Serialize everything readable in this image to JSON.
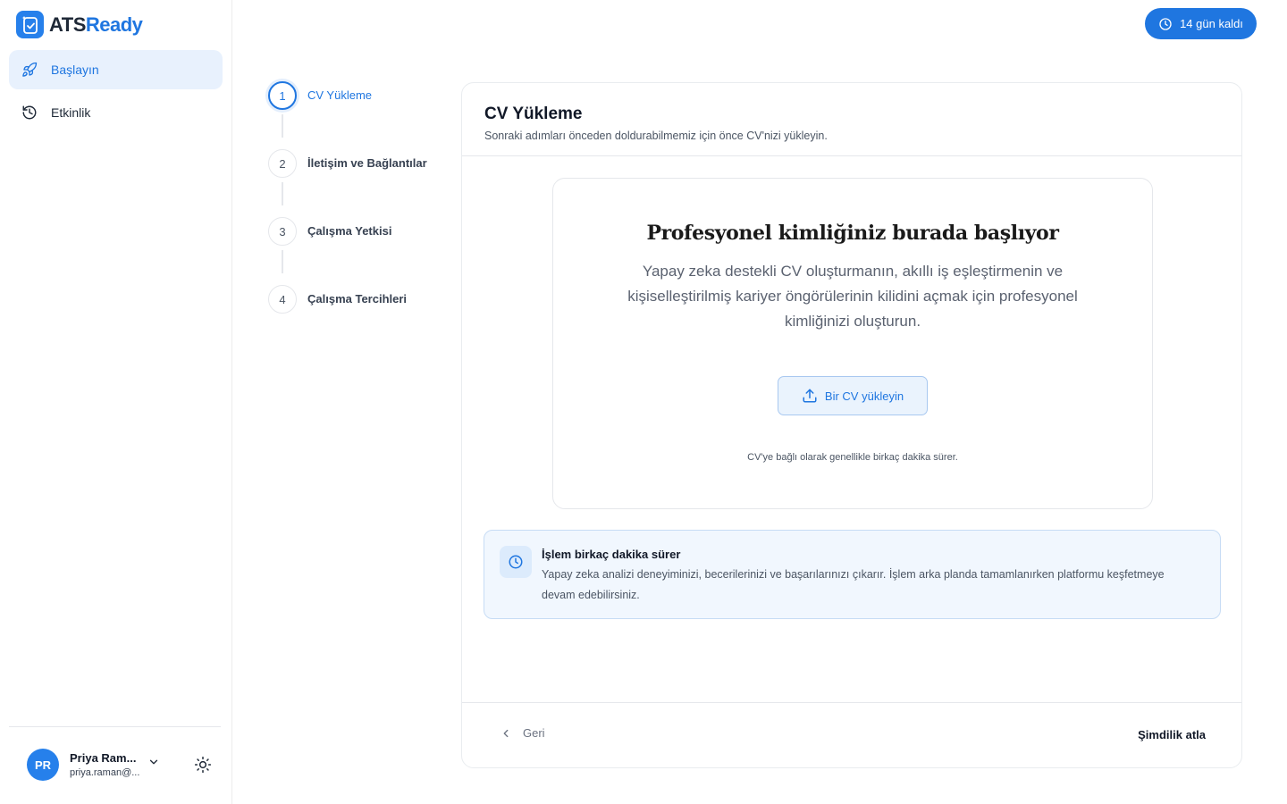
{
  "app": {
    "logo_prefix": "ATS",
    "logo_accent": "Ready",
    "brand_color": "#1f76e0"
  },
  "sidebar": {
    "items": [
      {
        "label": "Başlayın",
        "icon": "rocket-icon",
        "active": true
      },
      {
        "label": "Etkinlik",
        "icon": "history-icon",
        "active": false
      }
    ]
  },
  "user": {
    "initials": "PR",
    "name": "Priya Ram...",
    "email": "priya.raman@..."
  },
  "trial": {
    "label": "14 gün kaldı",
    "icon": "clock-icon"
  },
  "steps": [
    {
      "number": "1",
      "label": "CV Yükleme",
      "active": true
    },
    {
      "number": "2",
      "label": "İletişim ve Bağlantılar",
      "active": false
    },
    {
      "number": "3",
      "label": "Çalışma Yetkisi",
      "active": false
    },
    {
      "number": "4",
      "label": "Çalışma Tercihleri",
      "active": false
    }
  ],
  "card": {
    "title": "CV Yükleme",
    "subtitle": "Sonraki adımları önceden doldurabilmemiz için önce CV'nizi yükleyin.",
    "hero_title": "Profesyonel kimliğiniz burada başlıyor",
    "hero_desc": "Yapay zeka destekli CV oluşturmanın, akıllı iş eşleştirmenin ve kişiselleştirilmiş kariyer öngörülerinin kilidini açmak için profesyonel kimliğinizi oluşturun.",
    "upload_label": "Bir CV yükleyin",
    "upload_note": "CV'ye bağlı olarak genellikle birkaç dakika sürer.",
    "info_title": "İşlem birkaç dakika sürer",
    "info_text": "Yapay zeka analizi deneyiminizi, becerilerinizi ve başarılarınızı çıkarır. İşlem arka planda tamamlanırken platformu keşfetmeye devam edebilirsiniz.",
    "back_label": "Geri",
    "skip_label": "Şimdilik atla"
  }
}
